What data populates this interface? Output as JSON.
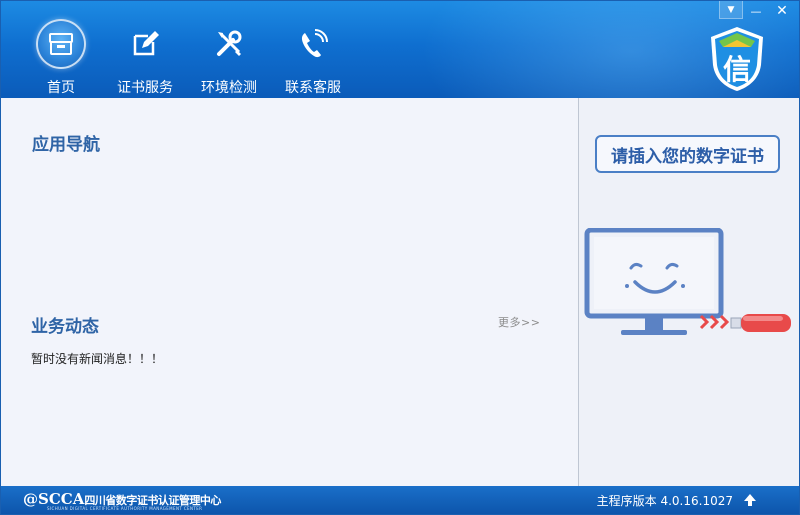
{
  "window": {
    "controls": {
      "menu": "▼",
      "minimize": "—",
      "close": "✕"
    }
  },
  "nav": [
    {
      "label": "首页",
      "icon": "archive-box-icon",
      "active": true
    },
    {
      "label": "证书服务",
      "icon": "edit-icon",
      "active": false
    },
    {
      "label": "环境检测",
      "icon": "tools-icon",
      "active": false
    },
    {
      "label": "联系客服",
      "icon": "phone-icon",
      "active": false
    }
  ],
  "logo": {
    "text": "信"
  },
  "main": {
    "app_nav_title": "应用导航",
    "news_title": "业务动态",
    "more_label": "更多>>",
    "news_empty": "暂时没有新闻消息！！！"
  },
  "side": {
    "insert_prompt": "请插入您的数字证书"
  },
  "footer": {
    "org_logo": "@SCCA",
    "org_name": "四川省数字证书认证管理中心",
    "org_name_en": "SICHUAN DIGITAL CERTIFICATE AUTHORITY MANAGEMENT CENTER",
    "version": "主程序版本 4.0.16.1027"
  },
  "colors": {
    "header": "#0f6fd0",
    "accent": "#2f64a6",
    "footer": "#0d55ab",
    "usb_red": "#e84a4a"
  }
}
